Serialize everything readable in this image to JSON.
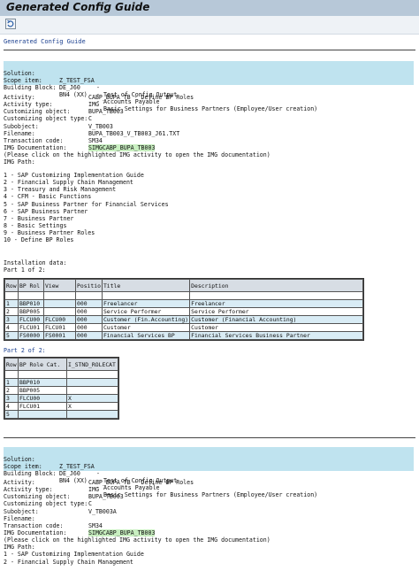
{
  "title": "Generated Config Guide",
  "page_link": "Generated Config Guide",
  "sections": [
    {
      "header": [
        {
          "label": "Solution:",
          "code": "Z_TEST_FSA",
          "text": "Test of Config Output"
        },
        {
          "label": "Scope item:",
          "code": "DE_J60",
          "text": "Accounts Payable"
        },
        {
          "label": "Building Block:",
          "code": "BN4 (XX)",
          "text": "Basic Settings for Business Partners (Employee/User creation)"
        }
      ],
      "fields": [
        {
          "label": "Activity:",
          "value": "CABP_BUPA_TB - Define BP Roles"
        },
        {
          "label": "Activity type:",
          "value": "IMG"
        },
        {
          "label": "Customizing object:",
          "value": "BUPA_TB003"
        },
        {
          "label": "Customizing object type:",
          "value": "C"
        },
        {
          "label": "Subobject:",
          "value": "V_TB003"
        },
        {
          "label": "Filename:",
          "value": "BUPA_TB003_V_TB003_J61.TXT"
        },
        {
          "label": "Transaction code:",
          "value": "SM34"
        },
        {
          "label": "IMG Documentation:",
          "value": "SIMGCABP_BUPA_TB003"
        }
      ],
      "note": "(Please click on the highlighted IMG activity to open the IMG documentation)",
      "img_path_label": "IMG Path:",
      "img_path": [
        "1 - SAP Customizing Implementation Guide",
        "2 - Financial Supply Chain Management",
        "3 - Treasury and Risk Management",
        "4 - CFM - Basic Functions",
        "5 - SAP Business Partner for Financial Services",
        "6 - SAP Business Partner",
        "7 - Business Partner",
        "8 - Basic Settings",
        "9 - Business Partner Roles",
        "10 - Define BP Roles"
      ],
      "installation_label": "Installation data:",
      "part1_label": "Part 1 of 2:",
      "part1_headers": [
        "Row",
        "BP Rol",
        "View",
        "Positio",
        "Title",
        "Description"
      ],
      "part1_rows": [
        [
          "1",
          "BBP010",
          "",
          "000",
          "Freelancer",
          "Freelancer"
        ],
        [
          "2",
          "BBP005",
          "",
          "000",
          "Service Performer",
          "Service Performer"
        ],
        [
          "3",
          "FLCU00",
          "FLCU00",
          "000",
          "Customer (Fin.Accounting)",
          "Customer (Financial Accounting)"
        ],
        [
          "4",
          "FLCU01",
          "FLCU01",
          "000",
          "Customer",
          "Customer"
        ],
        [
          "5",
          "FS0000",
          "FS0001",
          "000",
          "Financial Services BP",
          "Financial Services Business Partner"
        ]
      ],
      "part2_label": "Part 2 of 2:",
      "part2_headers": [
        "Row",
        "BP Role Cat.",
        "I_STND_ROLECAT"
      ],
      "part2_rows": [
        [
          "1",
          "BBP010",
          ""
        ],
        [
          "2",
          "BBP005",
          ""
        ],
        [
          "3",
          "FLCU00",
          "X"
        ],
        [
          "4",
          "FLCU01",
          "X"
        ],
        [
          "5",
          "",
          ""
        ]
      ]
    },
    {
      "header": [
        {
          "label": "Solution:",
          "code": "Z_TEST_FSA",
          "text": "Test of Config Output"
        },
        {
          "label": "Scope item:",
          "code": "DE_J60",
          "text": "Accounts Payable"
        },
        {
          "label": "Building Block:",
          "code": "BN4 (XX)",
          "text": "Basic Settings for Business Partners (Employee/User creation)"
        }
      ],
      "fields": [
        {
          "label": "Activity:",
          "value": "CABP_BUPA_TB - Define BP Roles"
        },
        {
          "label": "Activity type:",
          "value": "IMG"
        },
        {
          "label": "Customizing object:",
          "value": "BUPA_TB003"
        },
        {
          "label": "Customizing object type:",
          "value": "C"
        },
        {
          "label": "Subobject:",
          "value": "V_TB003A"
        },
        {
          "label": "Filename:",
          "value": ""
        },
        {
          "label": "Transaction code:",
          "value": "SM34"
        },
        {
          "label": "IMG Documentation:",
          "value": "SIMGCABP_BUPA_TB003"
        }
      ],
      "note": "(Please click on the highlighted IMG activity to open the IMG documentation)",
      "img_path_label": "IMG Path:",
      "img_path": [
        "1 - SAP Customizing Implementation Guide",
        "2 - Financial Supply Chain Management"
      ]
    }
  ],
  "colors": {
    "titlebar": "#b7c8d8",
    "header_band": "#bfe3ef",
    "highlight": "#c8efc0",
    "link": "#1a3f8f"
  }
}
